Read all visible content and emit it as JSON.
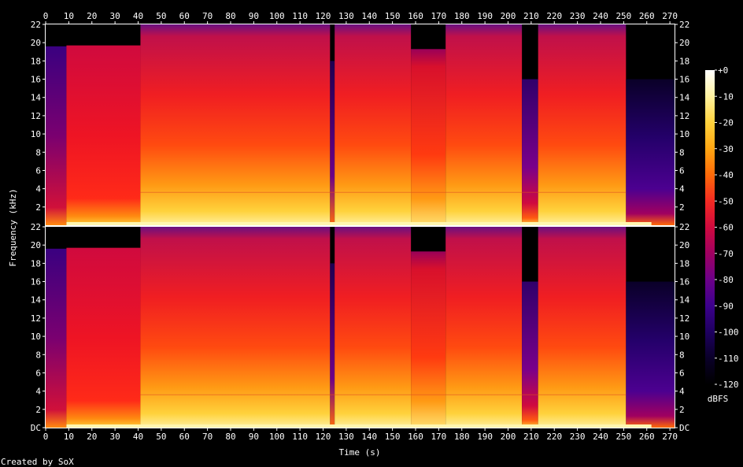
{
  "chart_data": {
    "type": "heatmap",
    "subtype": "spectrogram",
    "channels": 2,
    "xlabel": "Time (s)",
    "ylabel": "Frequency (kHz)",
    "x_ticks": [
      0,
      10,
      20,
      30,
      40,
      50,
      60,
      70,
      80,
      90,
      100,
      110,
      120,
      130,
      140,
      150,
      160,
      170,
      180,
      190,
      200,
      210,
      220,
      230,
      240,
      250,
      260,
      270
    ],
    "xlim": [
      0,
      272
    ],
    "y_ticks_top": [
      "22",
      "20",
      "18",
      "16",
      "14",
      "12",
      "10",
      "8",
      "6",
      "4",
      "2"
    ],
    "y_ticks_bottom": [
      "22",
      "20",
      "18",
      "16",
      "14",
      "12",
      "10",
      "8",
      "6",
      "4",
      "2",
      "DC"
    ],
    "ylim_khz": [
      0,
      22
    ],
    "colorbar": {
      "label": "dBFS",
      "ticks": [
        "+0",
        "-10",
        "-20",
        "-30",
        "-40",
        "-50",
        "-60",
        "-70",
        "-80",
        "-90",
        "-100",
        "-110",
        "-120"
      ],
      "range": [
        -120,
        0
      ],
      "stops": [
        {
          "v": 0,
          "color": "#ffffff"
        },
        {
          "v": -10,
          "color": "#fff2a0"
        },
        {
          "v": -20,
          "color": "#ffd23c"
        },
        {
          "v": -30,
          "color": "#ffa612"
        },
        {
          "v": -40,
          "color": "#ff6a08"
        },
        {
          "v": -50,
          "color": "#f42a22"
        },
        {
          "v": -60,
          "color": "#d00a3e"
        },
        {
          "v": -70,
          "color": "#a00060"
        },
        {
          "v": -80,
          "color": "#6c0088"
        },
        {
          "v": -90,
          "color": "#3c008c"
        },
        {
          "v": -100,
          "color": "#1e0060"
        },
        {
          "v": -110,
          "color": "#0a0028"
        },
        {
          "v": -120,
          "color": "#000000"
        }
      ]
    },
    "segments": [
      {
        "t0": 0,
        "t1": 9,
        "level": "quiet-intro",
        "cutoff_khz": 19.6
      },
      {
        "t0": 9,
        "t1": 41,
        "level": "medium",
        "cutoff_khz": 19.7
      },
      {
        "t0": 41,
        "t1": 123,
        "level": "loud",
        "cutoff_khz": 22
      },
      {
        "t0": 123,
        "t1": 125,
        "level": "gap",
        "cutoff_khz": 18
      },
      {
        "t0": 125,
        "t1": 158,
        "level": "loud",
        "cutoff_khz": 22
      },
      {
        "t0": 158,
        "t1": 173,
        "level": "medium-loud",
        "cutoff_khz": 19.3
      },
      {
        "t0": 173,
        "t1": 206,
        "level": "loud",
        "cutoff_khz": 22
      },
      {
        "t0": 206,
        "t1": 213,
        "level": "quiet-bridge",
        "cutoff_khz": 16
      },
      {
        "t0": 213,
        "t1": 251,
        "level": "loud",
        "cutoff_khz": 22
      },
      {
        "t0": 251,
        "t1": 272,
        "level": "fade-out",
        "cutoff_khz": 16
      }
    ]
  },
  "footer": {
    "credit": "Created by SoX"
  }
}
